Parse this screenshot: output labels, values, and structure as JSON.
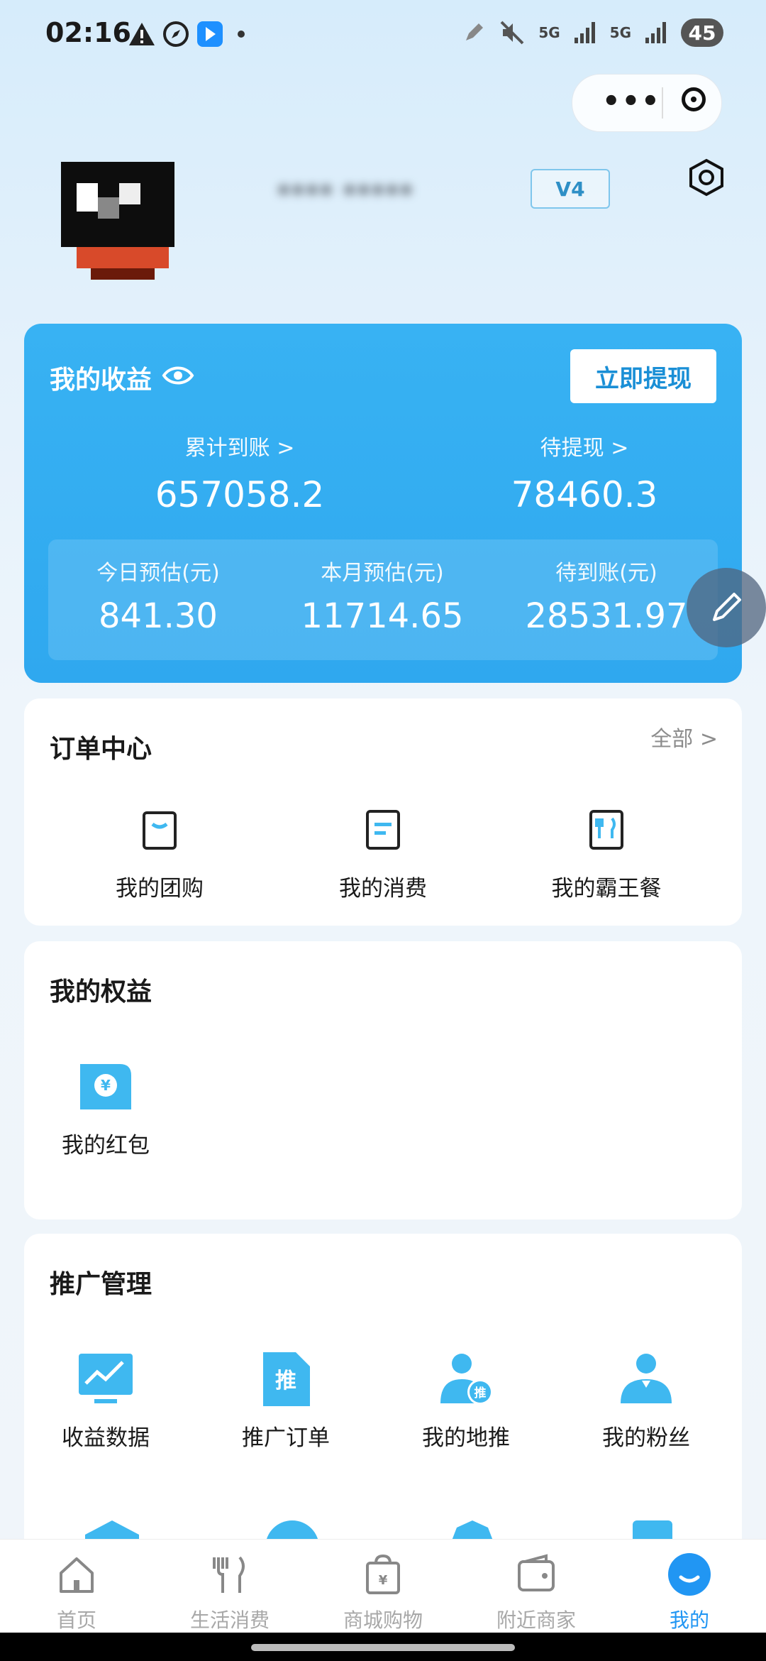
{
  "status_bar": {
    "time": "02:16",
    "net1": "5G",
    "net2": "5G",
    "battery": "45"
  },
  "profile": {
    "username": "**** *****",
    "level": "V4"
  },
  "earnings": {
    "title": "我的收益",
    "withdraw_label": "立即提现",
    "total_label": "累计到账 >",
    "total_value": "657058.2",
    "pending_label": "待提现 >",
    "pending_value": "78460.3",
    "today_label": "今日预估(元)",
    "today_value": "841.30",
    "month_label": "本月预估(元)",
    "month_value": "11714.65",
    "arriving_label": "待到账(元)",
    "arriving_value": "28531.97"
  },
  "orders": {
    "title": "订单中心",
    "more": "全部 >",
    "items": [
      {
        "label": "我的团购",
        "icon": "shopping-bag-icon"
      },
      {
        "label": "我的消费",
        "icon": "document-icon"
      },
      {
        "label": "我的霸王餐",
        "icon": "cutlery-icon"
      }
    ]
  },
  "benefits": {
    "title": "我的权益",
    "items": [
      {
        "label": "我的红包",
        "icon": "red-packet-icon"
      }
    ]
  },
  "promotion": {
    "title": "推广管理",
    "items": [
      {
        "label": "收益数据",
        "icon": "chart-icon"
      },
      {
        "label": "推广订单",
        "icon": "promo-order-icon"
      },
      {
        "label": "我的地推",
        "icon": "ground-promo-icon"
      },
      {
        "label": "我的粉丝",
        "icon": "fans-icon"
      }
    ]
  },
  "tabbar": {
    "items": [
      {
        "label": "首页",
        "icon": "home-icon"
      },
      {
        "label": "生活消费",
        "icon": "fork-knife-icon"
      },
      {
        "label": "商城购物",
        "icon": "shopping-icon"
      },
      {
        "label": "附近商家",
        "icon": "wallet-icon"
      },
      {
        "label": "我的",
        "icon": "profile-icon",
        "active": true
      }
    ]
  },
  "colors": {
    "accent": "#2196f3",
    "card_blue": "#38b2f3",
    "icon_blue": "#3fb8f0"
  }
}
